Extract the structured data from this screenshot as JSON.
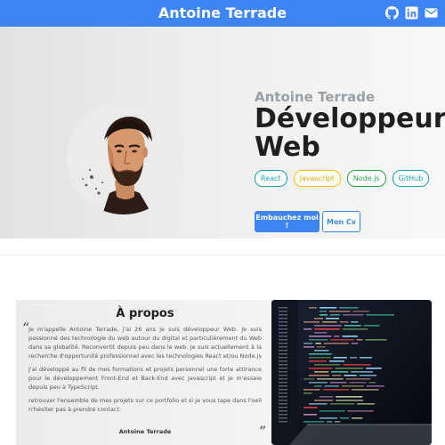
{
  "navbar": {
    "brand": "Antoine Terrade",
    "icons": [
      "github-icon",
      "linkedin-icon",
      "mail-icon"
    ],
    "background": "#3d84f5"
  },
  "hero": {
    "name": "Antoine Terrade",
    "title": "Développeur Web",
    "avatar": "avatar",
    "tags": {
      "react": "React",
      "javascript": "Javascript",
      "node": "Node.js",
      "github": "GitHub"
    },
    "buttons": {
      "hire": "Embauchez moi !",
      "cv": "Mon Cv"
    }
  },
  "about": {
    "title": "À propos",
    "paragraphs": [
      "Je m'appelle Antoine Terrade, j'ai 26 ans je suis développeur Web. Je suis passionné des technologie du web autour du digital et particulièrement du Web dans sa globalité. Reconvertit depuis peu dans le web. Je suis actuellement à la recherche d'opportunité professionnel avec les technologies React et/ou Node.js",
      "J'ai développé au fil de mes formations et projets personnel une forte attirance pour le développement Front-End et Back-End avec Javascript et je m'essaie depuis peu à TypeScript.",
      "retrouver l'ensemble de mes projets sur ce portfolio et si je vous tape dans l'oeil n'hésiter pas à prendre contact."
    ],
    "quote_open": "“",
    "quote_close": "”",
    "signature": "Antoine Terrade"
  },
  "colors": {
    "primary": "#3d84f5",
    "react": "#17a2b8",
    "javascript": "#ffc107",
    "node": "#28a745",
    "github": "#17a2b8"
  }
}
